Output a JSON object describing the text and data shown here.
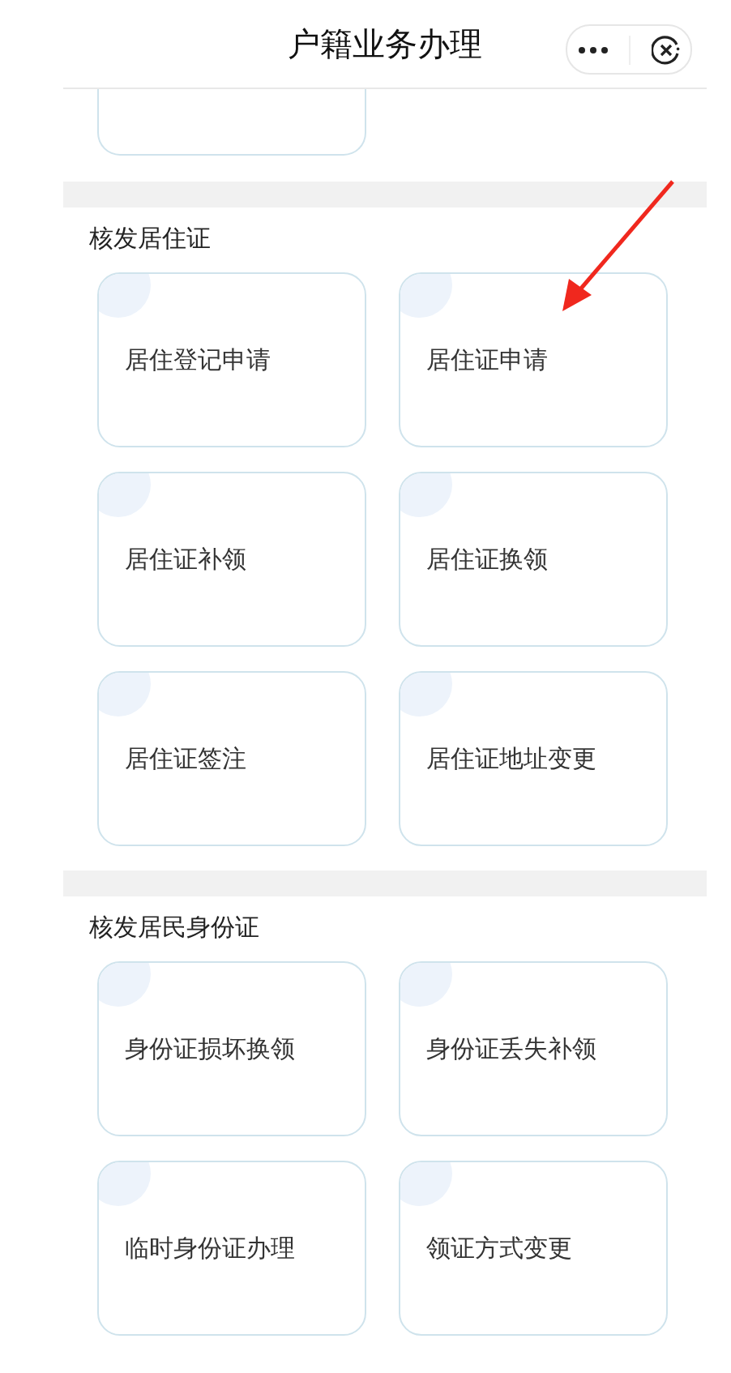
{
  "header": {
    "title": "户籍业务办理"
  },
  "sections": [
    {
      "title": "核发居住证",
      "items": [
        {
          "label": "居住登记申请"
        },
        {
          "label": "居住证申请"
        },
        {
          "label": "居住证补领"
        },
        {
          "label": "居住证换领"
        },
        {
          "label": "居住证签注"
        },
        {
          "label": "居住证地址变更"
        }
      ]
    },
    {
      "title": "核发居民身份证",
      "items": [
        {
          "label": "身份证损坏换领"
        },
        {
          "label": "身份证丢失补领"
        },
        {
          "label": "临时身份证办理"
        },
        {
          "label": "领证方式变更"
        }
      ]
    }
  ]
}
